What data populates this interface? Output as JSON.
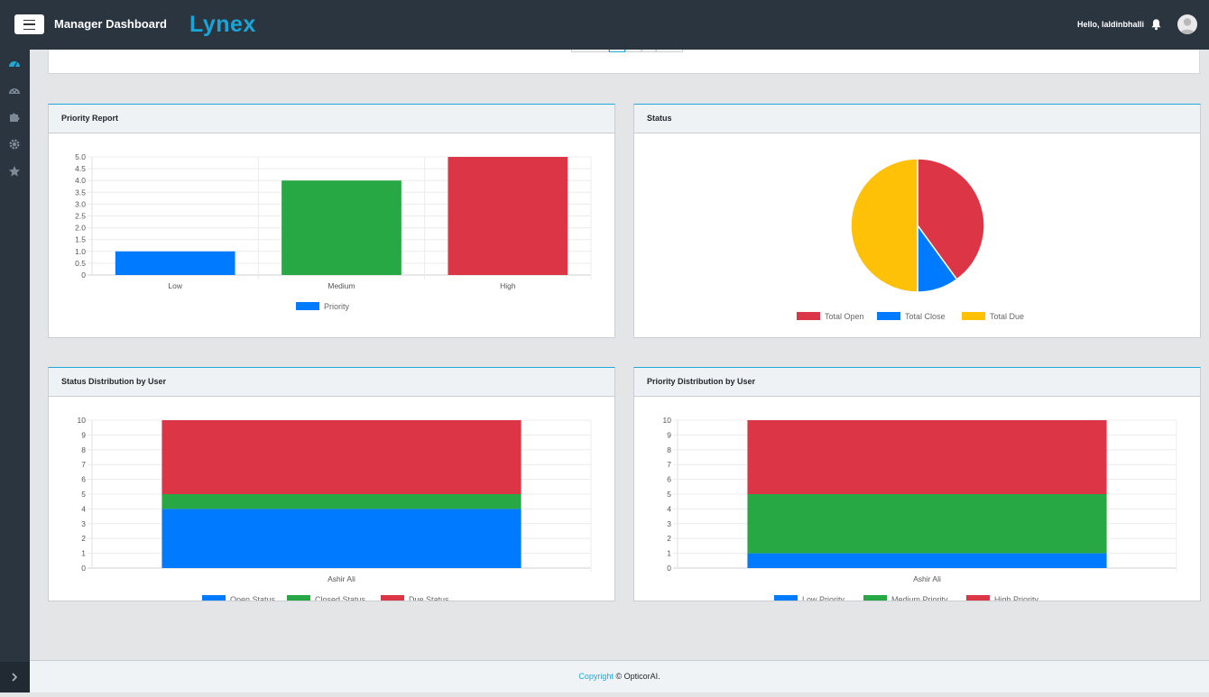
{
  "header": {
    "title": "Manager Dashboard",
    "brand": "Lynex",
    "greeting": "Hello, laldinbhalli",
    "icons": [
      "menu-icon",
      "bell-icon",
      "user-avatar-icon"
    ],
    "colors": {
      "bar_bg": "#2a3540",
      "brand": "#19a5d8"
    }
  },
  "sidebar": {
    "items": [
      "dashboard-icon",
      "palette-icon",
      "puzzle-icon",
      "gear-icon",
      "star-icon"
    ],
    "toggle_icon": "chevron-right-icon"
  },
  "cards": {
    "priority_report": "Priority Report",
    "status": "Status",
    "status_by_user": "Status Distribution by User",
    "priority_by_user": "Priority Distribution by User"
  },
  "chart_data": [
    {
      "id": "priority_report",
      "type": "bar",
      "categories": [
        "Low",
        "Medium",
        "High"
      ],
      "series": [
        {
          "name": "Priority",
          "values": [
            1,
            4,
            5
          ],
          "colors": [
            "#007bff",
            "#28a745",
            "#dc3545"
          ]
        }
      ],
      "legend": [
        {
          "label": "Priority",
          "color": "#007bff"
        }
      ],
      "ylim": [
        0,
        5
      ],
      "yticks": [
        "0",
        "0.5",
        "1.0",
        "1.5",
        "2.0",
        "2.5",
        "3.0",
        "3.5",
        "4.0",
        "4.5",
        "5.0"
      ],
      "grid": true,
      "legend_position": "bottom"
    },
    {
      "id": "status",
      "type": "pie",
      "slices": [
        {
          "label": "Total Open",
          "value": 4,
          "color": "#dc3545"
        },
        {
          "label": "Total Close",
          "value": 1,
          "color": "#007bff"
        },
        {
          "label": "Total Due",
          "value": 5,
          "color": "#ffc107"
        }
      ],
      "legend_position": "bottom"
    },
    {
      "id": "status_by_user",
      "type": "bar",
      "stacked": true,
      "categories": [
        "Ashir Ali"
      ],
      "series": [
        {
          "name": "Open Status",
          "values": [
            4
          ],
          "color": "#007bff"
        },
        {
          "name": "Closed Status",
          "values": [
            1
          ],
          "color": "#28a745"
        },
        {
          "name": "Due Status",
          "values": [
            5
          ],
          "color": "#dc3545"
        }
      ],
      "ylim": [
        0,
        10
      ],
      "yticks": [
        "0",
        "1",
        "2",
        "3",
        "4",
        "5",
        "6",
        "7",
        "8",
        "9",
        "10"
      ],
      "grid": true,
      "legend_position": "bottom"
    },
    {
      "id": "priority_by_user",
      "type": "bar",
      "stacked": true,
      "categories": [
        "Ashir Ali"
      ],
      "series": [
        {
          "name": "Low Priority",
          "values": [
            1
          ],
          "color": "#007bff"
        },
        {
          "name": "Medium Priority",
          "values": [
            4
          ],
          "color": "#28a745"
        },
        {
          "name": "High Priority",
          "values": [
            5
          ],
          "color": "#dc3545"
        }
      ],
      "ylim": [
        0,
        10
      ],
      "yticks": [
        "0",
        "1",
        "2",
        "3",
        "4",
        "5",
        "6",
        "7",
        "8",
        "9",
        "10"
      ],
      "grid": true,
      "legend_position": "bottom"
    }
  ],
  "footer": {
    "link_text": "Copyright",
    "rest": " © OpticorAI."
  }
}
